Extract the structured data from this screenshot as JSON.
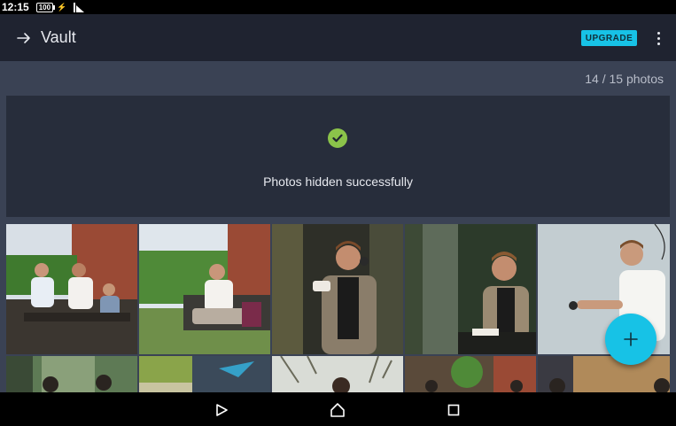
{
  "status": {
    "time": "12:15",
    "battery": "100"
  },
  "app_bar": {
    "title": "Vault",
    "upgrade_label": "UPGRADE"
  },
  "vault": {
    "count_label": "14 / 15 photos"
  },
  "banner": {
    "message": "Photos hidden successfully"
  },
  "colors": {
    "accent": "#17c2e6",
    "success": "#8bc34a",
    "app_bar_bg": "#1f2330",
    "content_bg": "#3a4254",
    "banner_bg": "#272d3b"
  },
  "icons": {
    "back": "arrow-right-icon",
    "more": "more-vert-icon",
    "check": "check-circle-icon",
    "fab": "plus-icon",
    "nav_back": "triangle-back-icon",
    "nav_home": "home-icon",
    "nav_recents": "square-recents-icon"
  }
}
